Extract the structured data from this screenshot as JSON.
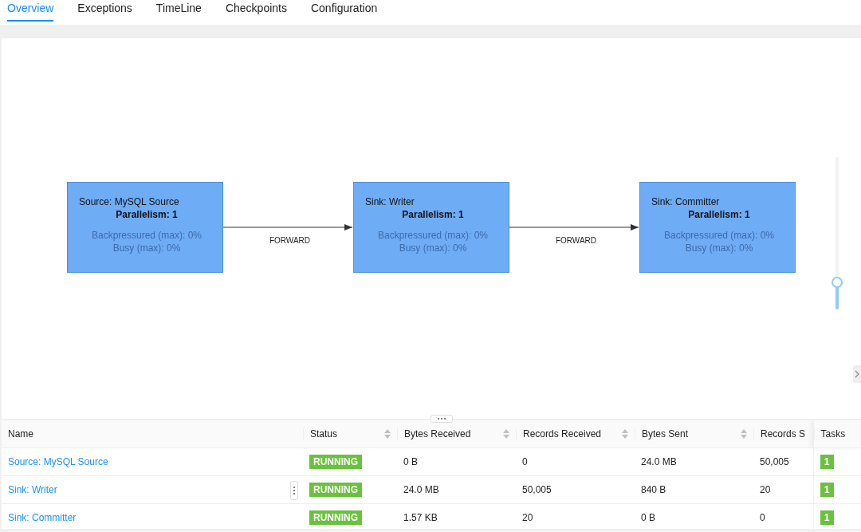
{
  "tabs": [
    {
      "label": "Overview",
      "selected": true
    },
    {
      "label": "Exceptions",
      "selected": false
    },
    {
      "label": "TimeLine",
      "selected": false
    },
    {
      "label": "Checkpoints",
      "selected": false
    },
    {
      "label": "Configuration",
      "selected": false
    }
  ],
  "graph": {
    "nodes": [
      {
        "title": "Source: MySQL Source",
        "parallelism": "Parallelism: 1",
        "backpressure": "Backpressured (max): 0%",
        "busy": "Busy (max): 0%"
      },
      {
        "title": "Sink: Writer",
        "parallelism": "Parallelism: 1",
        "backpressure": "Backpressured (max): 0%",
        "busy": "Busy (max): 0%"
      },
      {
        "title": "Sink: Committer",
        "parallelism": "Parallelism: 1",
        "backpressure": "Backpressured (max): 0%",
        "busy": "Busy (max): 0%"
      }
    ],
    "edges": [
      {
        "label": "FORWARD"
      },
      {
        "label": "FORWARD"
      }
    ],
    "zoom": {
      "level": 0.18
    }
  },
  "table": {
    "columns": [
      {
        "label": "Name",
        "sortable": false
      },
      {
        "label": "Status",
        "sortable": true
      },
      {
        "label": "Bytes Received",
        "sortable": true
      },
      {
        "label": "Records Received",
        "sortable": true
      },
      {
        "label": "Bytes Sent",
        "sortable": true
      },
      {
        "label": "Records S",
        "sortable": false
      },
      {
        "label": "Tasks",
        "sortable": false
      }
    ],
    "rows": [
      {
        "name": "Source: MySQL Source",
        "status": "RUNNING",
        "bytes_received": "0 B",
        "records_received": "0",
        "bytes_sent": "24.0 MB",
        "records_sent": "50,005",
        "tasks": "1"
      },
      {
        "name": "Sink: Writer",
        "status": "RUNNING",
        "bytes_received": "24.0 MB",
        "records_received": "50,005",
        "bytes_sent": "840 B",
        "records_sent": "20",
        "tasks": "1"
      },
      {
        "name": "Sink: Committer",
        "status": "RUNNING",
        "bytes_received": "1.57 KB",
        "records_received": "20",
        "bytes_sent": "0 B",
        "records_sent": "0",
        "tasks": "1"
      }
    ]
  }
}
